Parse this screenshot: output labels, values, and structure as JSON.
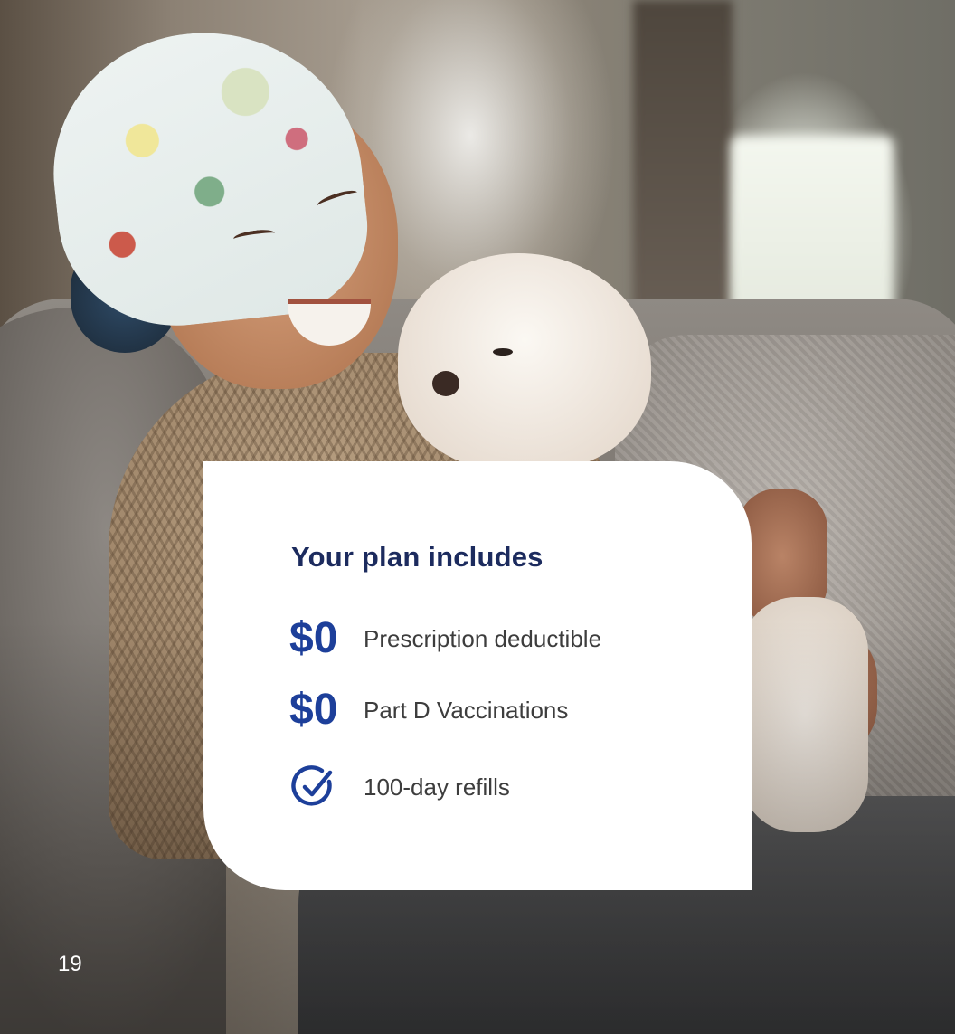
{
  "card": {
    "title": "Your plan includes",
    "items": [
      {
        "amount": "$0",
        "label": "Prescription deductible"
      },
      {
        "amount": "$0",
        "label": "Part D Vaccinations"
      },
      {
        "icon": "check-circle-icon",
        "label": "100-day refills"
      }
    ]
  },
  "page_number": "19",
  "colors": {
    "title": "#1c2b5e",
    "accent": "#1d3f9a",
    "card_background": "#ffffff"
  }
}
